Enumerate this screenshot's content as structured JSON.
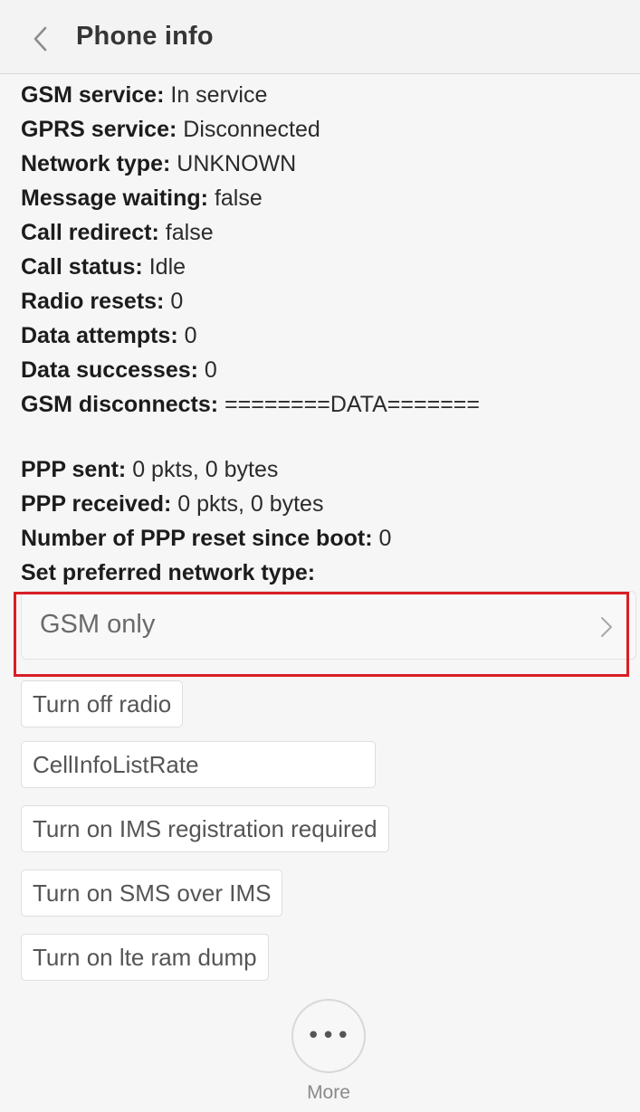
{
  "header": {
    "title": "Phone info"
  },
  "info": [
    {
      "key": "GSM service:",
      "value": "In service"
    },
    {
      "key": "GPRS service:",
      "value": "Disconnected"
    },
    {
      "key": "Network type:",
      "value": "UNKNOWN"
    },
    {
      "key": "Message waiting:",
      "value": "false"
    },
    {
      "key": "Call redirect:",
      "value": "false"
    },
    {
      "key": "Call status:",
      "value": "Idle"
    },
    {
      "key": "Radio resets:",
      "value": "0"
    },
    {
      "key": "Data attempts:",
      "value": "0"
    },
    {
      "key": "Data successes:",
      "value": "0"
    },
    {
      "key": "GSM disconnects:",
      "value": "========DATA======="
    },
    {
      "key": "PPP sent:",
      "value": "0 pkts, 0 bytes"
    },
    {
      "key": "PPP received:",
      "value": "0 pkts, 0 bytes"
    },
    {
      "key": "Number of PPP reset since boot:",
      "value": "0"
    },
    {
      "key": "Set preferred network type:",
      "value": ""
    }
  ],
  "network_type_spinner": {
    "selected": "GSM only"
  },
  "buttons": {
    "turn_off_radio": "Turn off radio",
    "cell_info_list_rate": "CellInfoListRate",
    "ims_registration": "Turn on IMS registration required",
    "sms_over_ims": "Turn on SMS over IMS",
    "lte_ram_dump": "Turn on lte ram dump"
  },
  "more": {
    "label": "More",
    "dots": "•••"
  },
  "icons": {
    "back": "chevron-left-icon",
    "spinner": "chevron-right-icon",
    "more": "more-dots-icon"
  },
  "colors": {
    "highlight": "#d91e26",
    "background": "#f6f6f6",
    "header": "#f3f3f3"
  }
}
